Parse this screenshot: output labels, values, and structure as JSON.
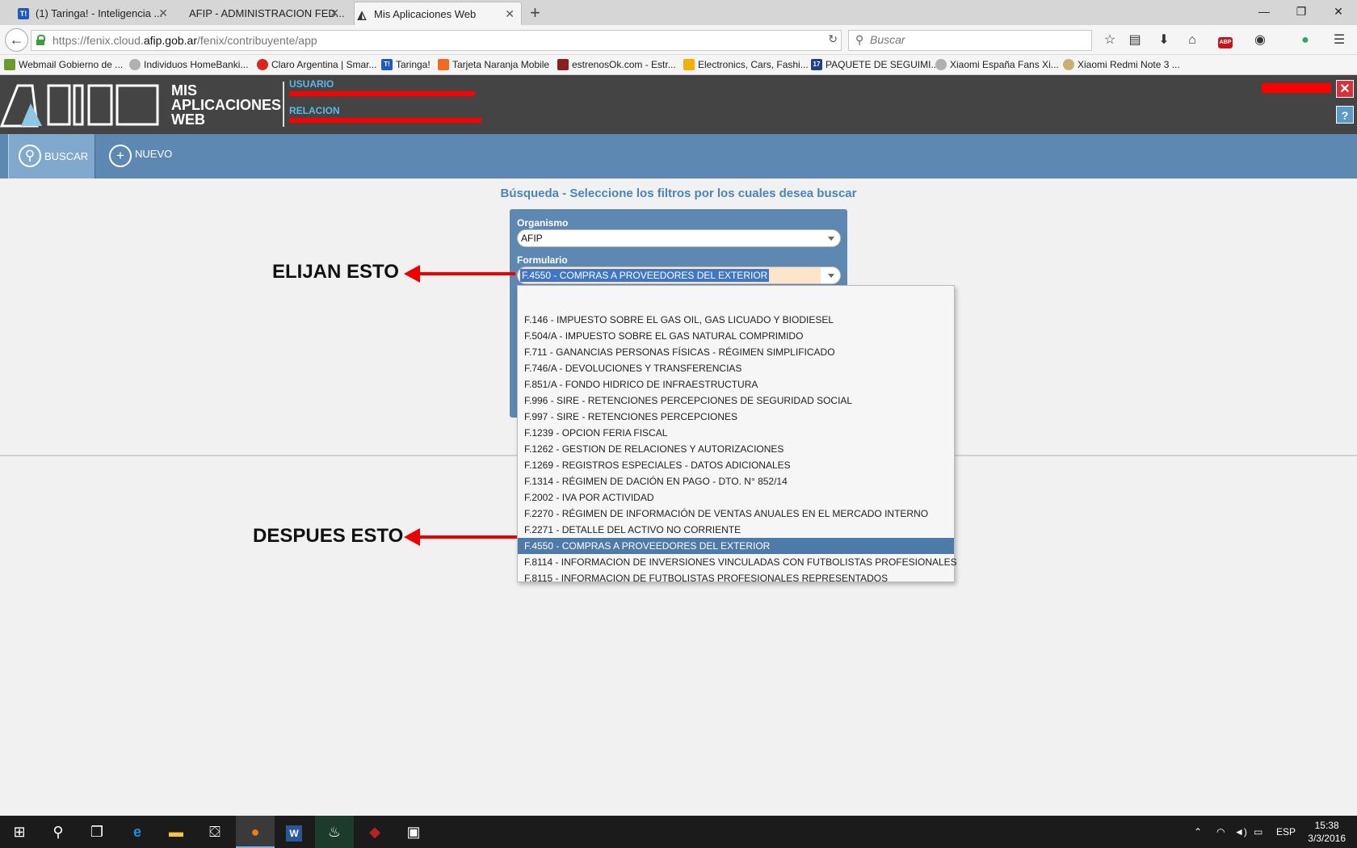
{
  "browser": {
    "tabs": [
      {
        "title": "(1) Taringa! - Inteligencia ...",
        "favicon": "T!",
        "favicon_color": "#1e5bb8"
      },
      {
        "title": "AFIP - ADMINISTRACION FED...",
        "favicon": "",
        "favicon_color": "#d6d6d6"
      },
      {
        "title": "Mis Aplicaciones Web",
        "favicon": "A",
        "favicon_color": "#333333"
      }
    ],
    "new_tab": "+",
    "url_prefix": "https://fenix.cloud.",
    "url_domain": "afip.gob.ar",
    "url_path": "/fenix/contribuyente/app",
    "search_placeholder": "Buscar",
    "window_controls": {
      "minimize": "—",
      "restore": "❐",
      "close": "✕"
    }
  },
  "bookmarks": [
    {
      "label": "Webmail Gobierno de ...",
      "icon": "page-icon",
      "color": "#6b9a2c"
    },
    {
      "label": "Individuos HomeBanki...",
      "icon": "globe-icon",
      "color": "#b0b0b0"
    },
    {
      "label": "Claro Argentina | Smar...",
      "icon": "claro-icon",
      "color": "#d8261d"
    },
    {
      "label": "Taringa!",
      "icon": "taringa-icon",
      "color": "#1e5bb8"
    },
    {
      "label": "Tarjeta Naranja Mobile",
      "icon": "naranja-icon",
      "color": "#f26b1d"
    },
    {
      "label": "estrenosOk.com - Estr...",
      "icon": "film-icon",
      "color": "#8a1f1f"
    },
    {
      "label": "Electronics, Cars, Fashi...",
      "icon": "ebay-icon",
      "color": "#f5af02"
    },
    {
      "label": "PAQUETE DE SEGUIMI...",
      "icon": "tracking-icon",
      "color": "#223f8a"
    },
    {
      "label": "Xiaomi España Fans Xi...",
      "icon": "globe-icon",
      "color": "#b0b0b0"
    },
    {
      "label": "Xiaomi Redmi Note 3 ...",
      "icon": "bowl-icon",
      "color": "#c8b070"
    }
  ],
  "header": {
    "app_title_lines": [
      "MIS",
      "APLICACIONES",
      "WEB"
    ],
    "usuario_label": "USUARIO",
    "relacion_label": "RELACION",
    "close": "✕",
    "help": "?"
  },
  "toolbar": {
    "buscar": "BUSCAR",
    "nuevo": "NUEVO"
  },
  "main": {
    "title": "Búsqueda - Seleccione los filtros por los cuales desea buscar",
    "organismo_label": "Organismo",
    "organismo_value": "AFIP",
    "formulario_label": "Formulario",
    "formulario_value": "F.4550 - COMPRAS A PROVEEDORES DEL EXTERIOR"
  },
  "dropdown_options": [
    "",
    "F.146 - IMPUESTO SOBRE EL GAS OIL, GAS LICUADO Y BIODIESEL",
    "F.504/A - IMPUESTO SOBRE EL GAS NATURAL COMPRIMIDO",
    "F.711 - GANANCIAS PERSONAS FÍSICAS - RÉGIMEN SIMPLIFICADO",
    "F.746/A - DEVOLUCIONES Y TRANSFERENCIAS",
    "F.851/A - FONDO HIDRICO DE INFRAESTRUCTURA",
    "F.996 - SIRE - RETENCIONES PERCEPCIONES DE SEGURIDAD SOCIAL",
    "F.997 - SIRE - RETENCIONES PERCEPCIONES",
    "F.1239 - OPCION FERIA FISCAL",
    "F.1262 - GESTION DE RELACIONES Y AUTORIZACIONES",
    "F.1269 - REGISTROS ESPECIALES - DATOS ADICIONALES",
    "F.1314 - RÉGIMEN DE DACIÓN EN PAGO - DTO. N° 852/14",
    "F.2002 - IVA POR ACTIVIDAD",
    "F.2270 - RÉGIMEN DE INFORMACIÓN DE VENTAS ANUALES EN EL MERCADO INTERNO",
    "F.2271 - DETALLE DEL ACTIVO NO CORRIENTE",
    "F.4550 - COMPRAS A PROVEEDORES DEL EXTERIOR",
    "F.8114 - INFORMACION DE INVERSIONES VINCULADAS CON FUTBOLISTAS PROFESIONALES",
    "F.8115 - INFORMACION DE FUTBOLISTAS PROFESIONALES REPRESENTADOS"
  ],
  "selected_option_index": 15,
  "annotations": {
    "first": "ELIJAN ESTO",
    "second": "DESPUES ESTO"
  },
  "taskbar": {
    "language": "ESP",
    "time": "15:38",
    "date": "3/3/2016"
  },
  "colors": {
    "header_bg": "#444444",
    "toolbar_bg": "#5d88b2",
    "accent_blue": "#4a84ba",
    "selected_row": "#4e7aa9",
    "annotation_red": "#ee0000"
  }
}
